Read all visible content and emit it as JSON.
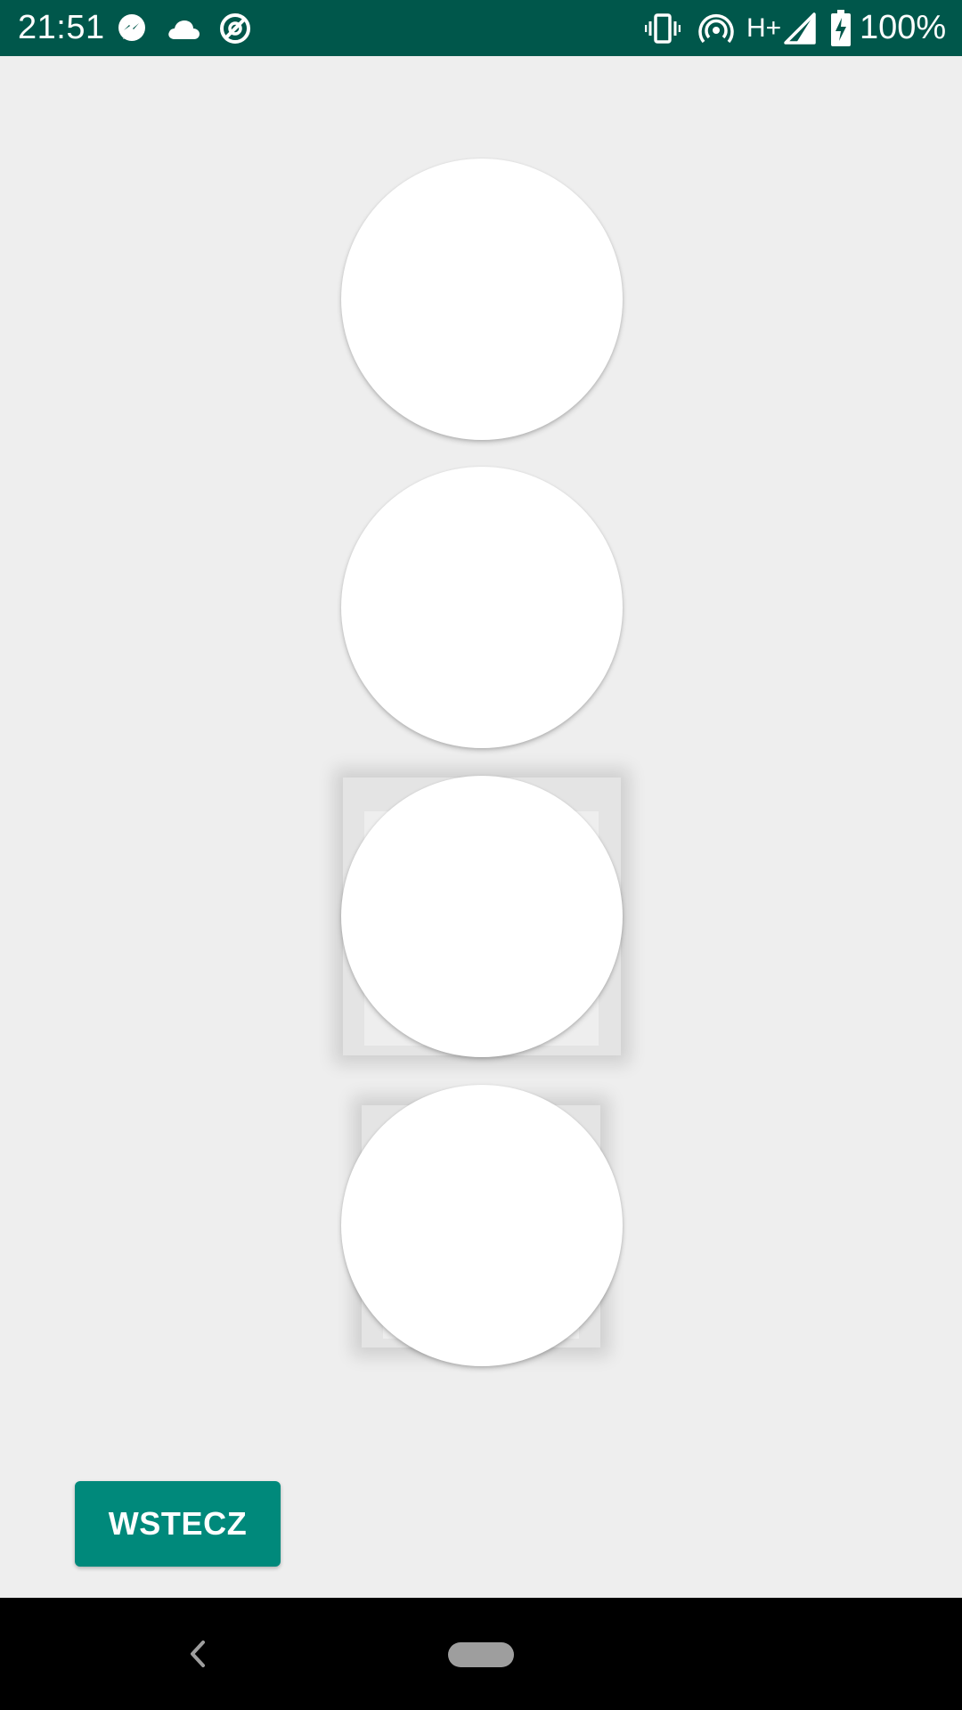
{
  "status_bar": {
    "time": "21:51",
    "network_type": "H+",
    "battery": "100%",
    "notification_icons": [
      "messenger-icon",
      "cloud-icon",
      "sync-disabled-icon"
    ],
    "system_icons": [
      "vibrate-icon",
      "hotspot-icon",
      "signal-icon",
      "battery-charging-icon"
    ],
    "background_color": "#00574b"
  },
  "content": {
    "background_color": "#eeeeee",
    "back_button": {
      "label": "WSTECZ",
      "color": "#00897b"
    }
  },
  "nav_bar": {
    "buttons": [
      "back-icon",
      "home-pill"
    ]
  }
}
